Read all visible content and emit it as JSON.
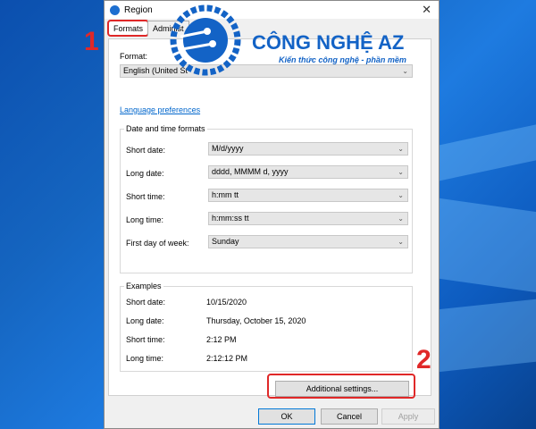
{
  "window": {
    "title": "Region"
  },
  "tabs": [
    {
      "label": "Formats"
    },
    {
      "label": "Administ"
    }
  ],
  "format": {
    "label": "Format:",
    "value": "English (United St"
  },
  "language_link": "Language preferences",
  "date_time": {
    "group_title": "Date and time formats",
    "rows": [
      {
        "label": "Short date:",
        "value": "M/d/yyyy"
      },
      {
        "label": "Long date:",
        "value": "dddd, MMMM d, yyyy"
      },
      {
        "label": "Short time:",
        "value": "h:mm tt"
      },
      {
        "label": "Long time:",
        "value": "h:mm:ss tt"
      },
      {
        "label": "First day of week:",
        "value": "Sunday"
      }
    ]
  },
  "examples": {
    "group_title": "Examples",
    "rows": [
      {
        "label": "Short date:",
        "value": "10/15/2020"
      },
      {
        "label": "Long date:",
        "value": "Thursday, October 15, 2020"
      },
      {
        "label": "Short time:",
        "value": "2:12 PM"
      },
      {
        "label": "Long time:",
        "value": "2:12:12 PM"
      }
    ]
  },
  "buttons": {
    "additional": "Additional settings...",
    "ok": "OK",
    "cancel": "Cancel",
    "apply": "Apply"
  },
  "annotations": {
    "step1": "1",
    "step2": "2"
  },
  "brand": {
    "name": "CÔNG NGHỆ AZ",
    "tagline": "Kiến thức công nghệ - phần mềm"
  },
  "icons": {
    "close": "close-icon",
    "globe": "globe-icon",
    "dropdown": "chevron-down-icon"
  },
  "colors": {
    "accent": "#0078d7",
    "highlight": "#e02828",
    "brand": "#1363c6"
  }
}
